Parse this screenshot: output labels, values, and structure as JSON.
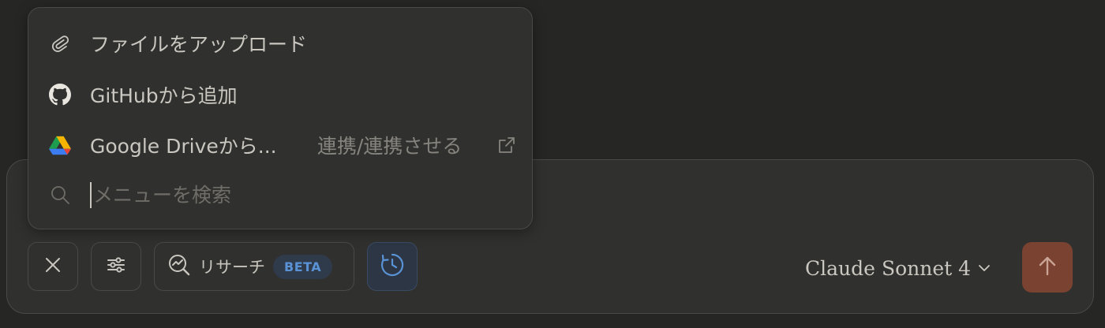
{
  "menu": {
    "upload_label": "ファイルをアップロード",
    "github_label": "GitHubから追加",
    "gdrive_label": "Google Driveから...",
    "gdrive_connect": "連携/連携させる",
    "search_placeholder": "メニューを検索"
  },
  "toolbar": {
    "research_label": "リサーチ",
    "research_badge": "BETA"
  },
  "model": {
    "brand": "Claude",
    "name": "Sonnet 4"
  },
  "icons": {
    "upload": "paperclip-icon",
    "github": "github-icon",
    "gdrive": "google-drive-icon",
    "external": "external-link-icon",
    "search": "search-icon",
    "close": "close-icon",
    "settings": "sliders-icon",
    "research": "research-icon",
    "history": "clock-icon",
    "send": "arrow-up-icon"
  },
  "colors": {
    "background": "#262624",
    "panel": "#30302e",
    "send_button": "#7a4230",
    "accent_blue": "#5a92d6"
  }
}
